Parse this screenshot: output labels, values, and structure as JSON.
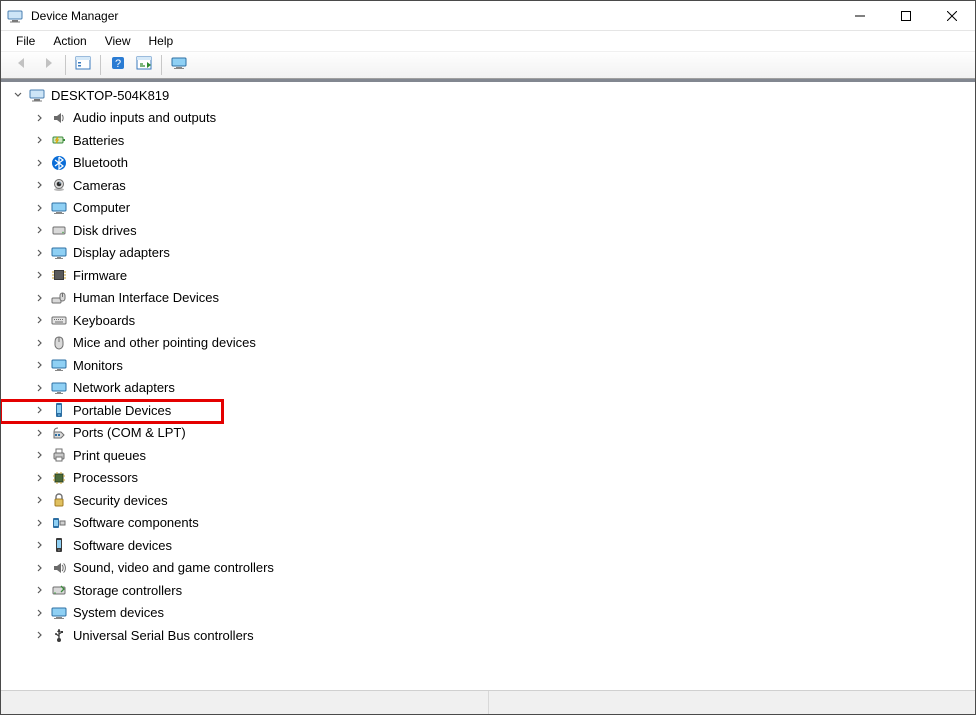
{
  "window": {
    "title": "Device Manager"
  },
  "menu": {
    "file": "File",
    "action": "Action",
    "view": "View",
    "help": "Help"
  },
  "tree": {
    "root": "DESKTOP-504K819",
    "items": [
      "Audio inputs and outputs",
      "Batteries",
      "Bluetooth",
      "Cameras",
      "Computer",
      "Disk drives",
      "Display adapters",
      "Firmware",
      "Human Interface Devices",
      "Keyboards",
      "Mice and other pointing devices",
      "Monitors",
      "Network adapters",
      "Portable Devices",
      "Ports (COM & LPT)",
      "Print queues",
      "Processors",
      "Security devices",
      "Software components",
      "Software devices",
      "Sound, video and game controllers",
      "Storage controllers",
      "System devices",
      "Universal Serial Bus controllers"
    ],
    "highlighted_index": 13
  }
}
